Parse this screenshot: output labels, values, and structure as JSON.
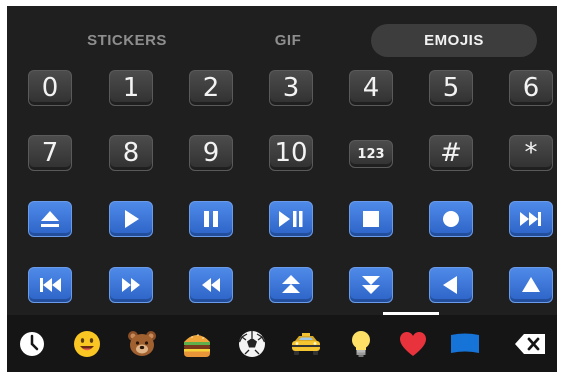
{
  "tabs": [
    {
      "label": "STICKERS",
      "active": false
    },
    {
      "label": "GIF",
      "active": false
    },
    {
      "label": "EMOJIS",
      "active": true
    }
  ],
  "emoji_rows": [
    [
      {
        "name": "keycap-0",
        "label": "0"
      },
      {
        "name": "keycap-1",
        "label": "1"
      },
      {
        "name": "keycap-2",
        "label": "2"
      },
      {
        "name": "keycap-3",
        "label": "3"
      },
      {
        "name": "keycap-4",
        "label": "4"
      },
      {
        "name": "keycap-5",
        "label": "5"
      },
      {
        "name": "keycap-6",
        "label": "6"
      }
    ],
    [
      {
        "name": "keycap-7",
        "label": "7"
      },
      {
        "name": "keycap-8",
        "label": "8"
      },
      {
        "name": "keycap-9",
        "label": "9"
      },
      {
        "name": "keycap-10",
        "label": "10"
      },
      {
        "name": "input-numbers",
        "label": "123"
      },
      {
        "name": "keycap-hash",
        "label": "#"
      },
      {
        "name": "keycap-asterisk",
        "label": "*"
      }
    ],
    [
      {
        "name": "eject-icon"
      },
      {
        "name": "play-icon"
      },
      {
        "name": "pause-icon"
      },
      {
        "name": "play-pause-icon"
      },
      {
        "name": "stop-icon"
      },
      {
        "name": "record-icon"
      },
      {
        "name": "next-track-icon"
      }
    ],
    [
      {
        "name": "previous-track-icon"
      },
      {
        "name": "fast-forward-icon"
      },
      {
        "name": "rewind-icon"
      },
      {
        "name": "fast-up-icon"
      },
      {
        "name": "fast-down-icon"
      },
      {
        "name": "reverse-icon"
      },
      {
        "name": "up-icon"
      }
    ]
  ],
  "categories": [
    {
      "name": "recent-clock-icon",
      "label": "recent"
    },
    {
      "name": "smileys-icon",
      "label": "smileys"
    },
    {
      "name": "animals-bear-icon",
      "label": "animals"
    },
    {
      "name": "food-burger-icon",
      "label": "food"
    },
    {
      "name": "activities-soccer-icon",
      "label": "activities"
    },
    {
      "name": "travel-taxi-icon",
      "label": "travel"
    },
    {
      "name": "objects-bulb-icon",
      "label": "objects"
    },
    {
      "name": "symbols-heart-icon",
      "label": "symbols"
    },
    {
      "name": "flags-icon",
      "label": "flags"
    }
  ],
  "delete_icon": "backspace-icon",
  "colors": {
    "background": "#1f1f1f",
    "tab_active_bg": "#3d3d3d",
    "tab_text": "#8e8e8e",
    "blue_key": "#3b73d6",
    "dark_key": "#3c3c3c"
  }
}
